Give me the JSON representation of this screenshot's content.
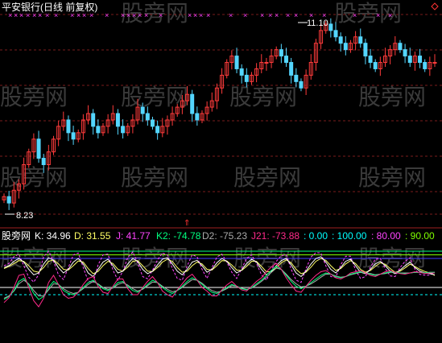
{
  "window": {
    "title": "平安银行(日线 前复权)",
    "indicator_name": "股旁网",
    "watermark": "股旁网"
  },
  "colors": {
    "background": "#000000",
    "grid": "#7a1c1c",
    "up_candle": "#ff3b3b",
    "down_candle": "#54d6ff",
    "signal_x": "#ff44ff",
    "title": "#ffffff",
    "K": "#ffffff",
    "D": "#ffff66",
    "J": "#ff44ff",
    "K2": "#00ff7f",
    "D2": "#aaaaaa",
    "J21": "#ff2a8a",
    "L0": "#00ffff",
    "L100": "#00ffff",
    "L80": "#ff44ff",
    "L90": "#7fff00"
  },
  "chart_data": [
    {
      "type": "candlestick",
      "title": "平安银行(日线 前复权)",
      "annotations": [
        {
          "text": "8.23",
          "type": "low_marker"
        },
        {
          "text": "11.10",
          "type": "high_marker"
        }
      ],
      "up_color": "#ff3b3b",
      "down_color": "#54d6ff",
      "grid": true,
      "series": [
        {
          "name": "price",
          "values": [
            8.4,
            8.3,
            8.5,
            8.6,
            8.9,
            9.1,
            9.3,
            9.0,
            8.9,
            9.1,
            9.3,
            9.5,
            9.6,
            9.4,
            9.3,
            9.4,
            9.6,
            9.7,
            9.5,
            9.4,
            9.5,
            9.6,
            9.7,
            9.5,
            9.4,
            9.5,
            9.6,
            9.8,
            9.7,
            9.6,
            9.5,
            9.4,
            9.5,
            9.6,
            9.7,
            9.8,
            9.9,
            10.0,
            9.7,
            9.6,
            9.7,
            9.8,
            9.9,
            10.1,
            10.3,
            10.5,
            10.6,
            10.4,
            10.3,
            10.2,
            10.3,
            10.4,
            10.5,
            10.5,
            10.6,
            10.7,
            10.6,
            10.5,
            10.3,
            10.2,
            10.1,
            10.3,
            10.5,
            10.8,
            11.0,
            11.1,
            11.0,
            10.9,
            10.8,
            10.7,
            10.8,
            10.9,
            10.8,
            10.6,
            10.5,
            10.4,
            10.5,
            10.6,
            10.7,
            10.8,
            10.7,
            10.6,
            10.5,
            10.6,
            10.5,
            10.4,
            10.5,
            10.5
          ]
        }
      ]
    },
    {
      "type": "line",
      "legend": [
        {
          "name": "K",
          "text": "K: 34.96"
        },
        {
          "name": "D",
          "text": "D: 31.55"
        },
        {
          "name": "J",
          "text": "J: 41.77"
        },
        {
          "name": "K2",
          "text": "K2: -74.78"
        },
        {
          "name": "D2",
          "text": "D2: -75.23"
        },
        {
          "name": "J21",
          "text": "J21: -73.88"
        },
        {
          "name": "L0",
          "text": ": 0.00"
        },
        {
          "name": "L100",
          "text": ": 100.00"
        },
        {
          "name": "L80",
          "text": ": 80.00"
        },
        {
          "name": "L90",
          "text": ": 90.00"
        }
      ],
      "series": [
        {
          "name": "K",
          "values": [
            55,
            60,
            72,
            80,
            70,
            50,
            35,
            40,
            65,
            82,
            75,
            55,
            40,
            50,
            70,
            80,
            65,
            40,
            30,
            50,
            70,
            78,
            60,
            40,
            45,
            65,
            80,
            72,
            50,
            38,
            45,
            62,
            78,
            82,
            65,
            45,
            35,
            50,
            70,
            75,
            60,
            42,
            50,
            68,
            80,
            72,
            55,
            40,
            48,
            66,
            78,
            70,
            50,
            35,
            45,
            60,
            74,
            80,
            62,
            40,
            30,
            45,
            65,
            80,
            85,
            70,
            50,
            40,
            55,
            72,
            78,
            60,
            42,
            38,
            50,
            65,
            72,
            60,
            45,
            38,
            48,
            60,
            70,
            55,
            45,
            40,
            38,
            35
          ]
        },
        {
          "name": "D",
          "values": [
            52,
            58,
            66,
            74,
            72,
            60,
            45,
            42,
            55,
            72,
            76,
            65,
            50,
            48,
            60,
            73,
            70,
            52,
            38,
            44,
            60,
            72,
            66,
            50,
            45,
            56,
            72,
            74,
            60,
            45,
            44,
            55,
            70,
            78,
            72,
            55,
            42,
            45,
            60,
            70,
            65,
            50,
            48,
            60,
            74,
            73,
            62,
            48,
            47,
            58,
            72,
            72,
            58,
            43,
            44,
            54,
            68,
            76,
            68,
            50,
            38,
            42,
            56,
            72,
            80,
            75,
            60,
            47,
            52,
            65,
            74,
            66,
            50,
            42,
            47,
            58,
            68,
            64,
            52,
            42,
            45,
            54,
            64,
            58,
            50,
            44,
            40,
            33
          ]
        },
        {
          "name": "J",
          "values": [
            60,
            66,
            85,
            92,
            60,
            28,
            15,
            35,
            85,
            100,
            72,
            35,
            22,
            55,
            90,
            95,
            55,
            18,
            14,
            62,
            90,
            92,
            48,
            20,
            45,
            83,
            98,
            68,
            30,
            24,
            48,
            76,
            95,
            90,
            52,
            25,
            20,
            60,
            90,
            85,
            50,
            25,
            55,
            84,
            92,
            70,
            42,
            25,
            52,
            80,
            90,
            66,
            35,
            20,
            48,
            72,
            88,
            90,
            50,
            20,
            14,
            52,
            84,
            96,
            95,
            60,
            30,
            28,
            62,
            86,
            86,
            48,
            25,
            30,
            56,
            78,
            80,
            52,
            32,
            30,
            55,
            72,
            82,
            50,
            36,
            34,
            34,
            42
          ]
        },
        {
          "name": "K2",
          "values": [
            -30,
            -35,
            -45,
            -60,
            -65,
            -55,
            -40,
            -30,
            -35,
            -50,
            -60,
            -55,
            -45,
            -40,
            -38,
            -42,
            -50,
            -58,
            -62,
            -55,
            -48,
            -45,
            -50,
            -58,
            -60,
            -52,
            -45,
            -42,
            -48,
            -55,
            -62,
            -58,
            -50,
            -44,
            -40,
            -45,
            -52,
            -60,
            -66,
            -62,
            -55,
            -48,
            -42,
            -40,
            -45,
            -50,
            -55,
            -52,
            -48,
            -46,
            -50,
            -56,
            -62,
            -70,
            -78,
            -85,
            -80,
            -70,
            -60,
            -52,
            -48,
            -52,
            -58,
            -64,
            -70,
            -74,
            -72,
            -68,
            -66,
            -68,
            -72,
            -74,
            -76,
            -74,
            -72,
            -70,
            -72,
            -74,
            -76,
            -75,
            -74,
            -73,
            -74,
            -75,
            -75,
            -74,
            -75,
            -75
          ]
        },
        {
          "name": "D2",
          "values": [
            -32,
            -36,
            -44,
            -56,
            -62,
            -56,
            -45,
            -36,
            -36,
            -46,
            -56,
            -55,
            -48,
            -43,
            -40,
            -42,
            -48,
            -55,
            -60,
            -56,
            -50,
            -47,
            -49,
            -55,
            -58,
            -54,
            -48,
            -44,
            -47,
            -53,
            -59,
            -58,
            -52,
            -47,
            -43,
            -45,
            -50,
            -57,
            -63,
            -62,
            -57,
            -50,
            -45,
            -42,
            -44,
            -48,
            -53,
            -52,
            -49,
            -47,
            -49,
            -54,
            -60,
            -67,
            -75,
            -82,
            -80,
            -72,
            -63,
            -56,
            -51,
            -52,
            -56,
            -61,
            -67,
            -72,
            -72,
            -69,
            -67,
            -68,
            -71,
            -73,
            -75,
            -74,
            -73,
            -71,
            -72,
            -73,
            -75,
            -75,
            -74,
            -74,
            -74,
            -75,
            -75,
            -74,
            -75,
            -75
          ]
        },
        {
          "name": "J21",
          "values": [
            -25,
            -33,
            -50,
            -70,
            -72,
            -50,
            -28,
            -18,
            -32,
            -58,
            -70,
            -55,
            -38,
            -32,
            -34,
            -42,
            -55,
            -65,
            -68,
            -52,
            -42,
            -40,
            -52,
            -64,
            -64,
            -48,
            -38,
            -38,
            -50,
            -60,
            -68,
            -58,
            -44,
            -38,
            -34,
            -46,
            -56,
            -66,
            -72,
            -62,
            -50,
            -44,
            -36,
            -36,
            -46,
            -54,
            -60,
            -52,
            -46,
            -44,
            -52,
            -60,
            -66,
            -76,
            -84,
            -90,
            -80,
            -66,
            -54,
            -44,
            -42,
            -52,
            -62,
            -70,
            -76,
            -78,
            -72,
            -66,
            -64,
            -68,
            -74,
            -76,
            -78,
            -74,
            -70,
            -68,
            -72,
            -76,
            -78,
            -75,
            -73,
            -72,
            -74,
            -76,
            -75,
            -73,
            -74,
            -74
          ]
        }
      ],
      "reference_lines": [
        0,
        80,
        90,
        100
      ]
    }
  ]
}
